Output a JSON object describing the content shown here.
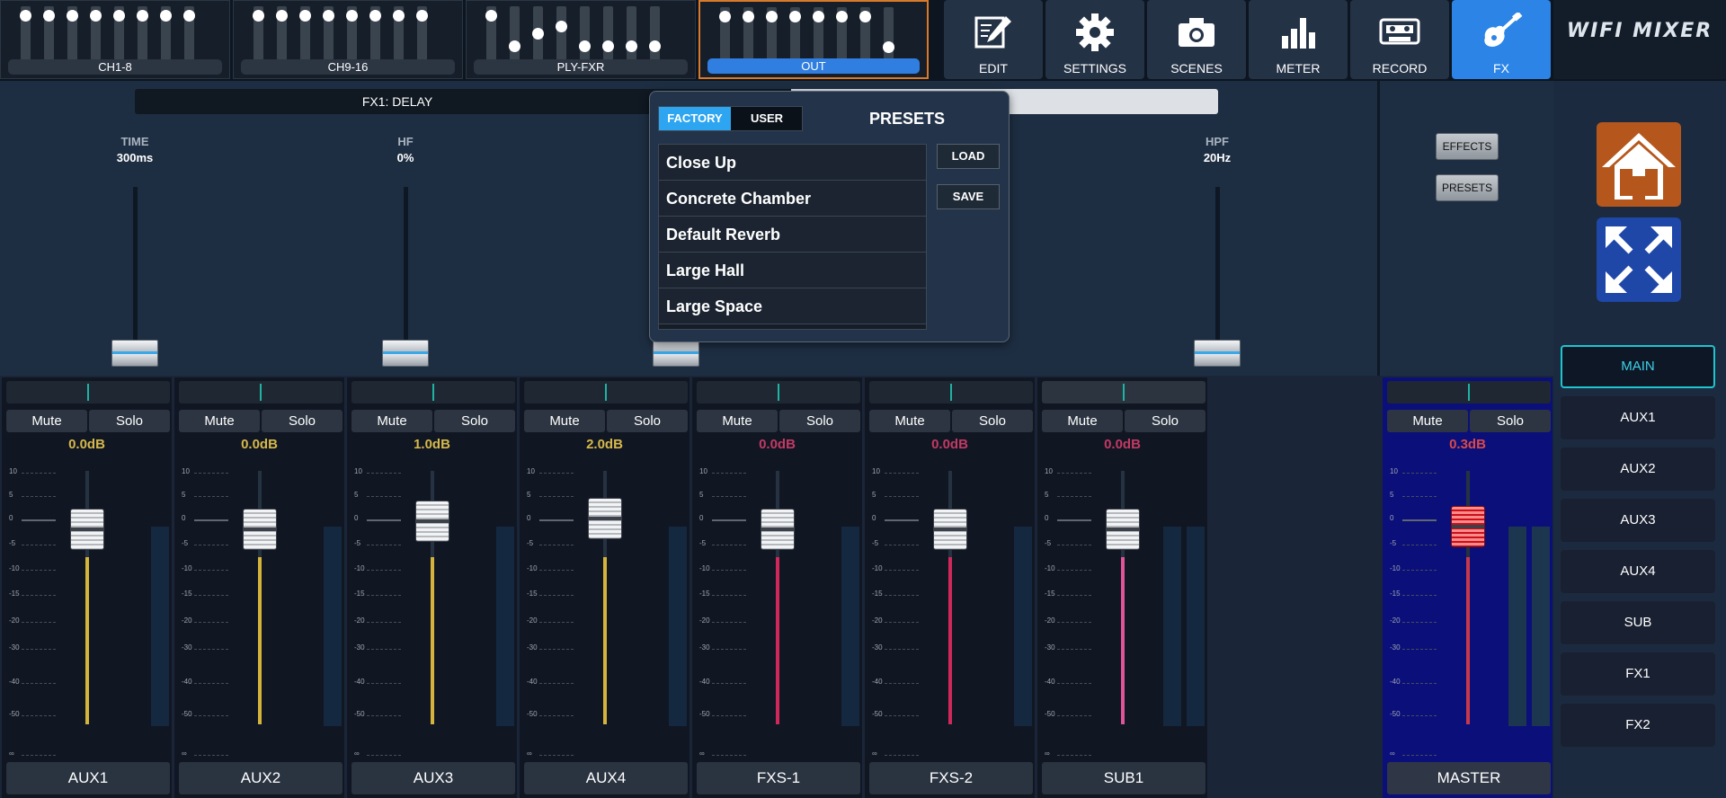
{
  "app": {
    "logo": "WIFI MIXER"
  },
  "banks": [
    {
      "label": "CH1-8",
      "levels": [
        0.92,
        0.92,
        0.92,
        0.92,
        0.92,
        0.92,
        0.92,
        0.92
      ],
      "active": false
    },
    {
      "label": "CH9-16",
      "levels": [
        0.92,
        0.92,
        0.92,
        0.92,
        0.92,
        0.92,
        0.92,
        0.92
      ],
      "active": false
    },
    {
      "label": "PLY-FXR",
      "levels": [
        0.92,
        0.2,
        0.5,
        0.65,
        0.2,
        0.2,
        0.2,
        0.2
      ],
      "active": false
    },
    {
      "label": "OUT",
      "levels": [
        0.92,
        0.92,
        0.92,
        0.92,
        0.92,
        0.92,
        0.92,
        0.2
      ],
      "active": true
    }
  ],
  "toolbar": [
    {
      "label": "EDIT",
      "icon": "edit-icon"
    },
    {
      "label": "SETTINGS",
      "icon": "gear-icon"
    },
    {
      "label": "SCENES",
      "icon": "camera-icon"
    },
    {
      "label": "METER",
      "icon": "bar-chart-icon"
    },
    {
      "label": "RECORD",
      "icon": "cassette-icon"
    },
    {
      "label": "FX",
      "icon": "guitar-icon",
      "active": true
    }
  ],
  "fx": {
    "name": "FX1: DELAY",
    "params": [
      {
        "name": "TIME",
        "value": "300ms",
        "level": 0.0
      },
      {
        "name": "HF",
        "value": "0%",
        "level": 0.0
      },
      {
        "name": "",
        "value": "",
        "level": 0.0
      },
      {
        "name": "HPF",
        "value": "20Hz",
        "level": 0.0
      }
    ],
    "effects_label": "EFFECTS",
    "presets_label": "PRESETS"
  },
  "presets": {
    "title": "PRESETS",
    "tabs": [
      "FACTORY",
      "USER"
    ],
    "selected_tab": "FACTORY",
    "items": [
      "Close Up",
      "Concrete Chamber",
      "Default Reverb",
      "Large Hall",
      "Large Space"
    ],
    "load_label": "LOAD",
    "save_label": "SAVE"
  },
  "mixer": {
    "mute_label": "Mute",
    "solo_label": "Solo",
    "scale": [
      "10",
      "5",
      "0",
      "-5",
      "-10",
      "-15",
      "-20",
      "-30",
      "-40",
      "-50",
      "∞"
    ],
    "strips": [
      {
        "name": "AUX1",
        "gain": "0.0dB",
        "gain_color": "#d6b94a",
        "line_color": "#d4b43a"
      },
      {
        "name": "AUX2",
        "gain": "0.0dB",
        "gain_color": "#d6b94a",
        "line_color": "#d4b43a"
      },
      {
        "name": "AUX3",
        "gain": "1.0dB",
        "gain_color": "#d6b94a",
        "line_color": "#d4b43a"
      },
      {
        "name": "AUX4",
        "gain": "2.0dB",
        "gain_color": "#d6b94a",
        "line_color": "#d4b43a"
      },
      {
        "name": "FXS-1",
        "gain": "0.0dB",
        "gain_color": "#c23a64",
        "line_color": "#d0285a"
      },
      {
        "name": "FXS-2",
        "gain": "0.0dB",
        "gain_color": "#c23a64",
        "line_color": "#d0285a"
      },
      {
        "name": "SUB1",
        "gain": "0.0dB",
        "gain_color": "#c23a64",
        "line_color": "#e0559a"
      },
      {
        "name": "MASTER",
        "gain": "0.3dB",
        "gain_color": "#d94a4a",
        "line_color": "#c8384a"
      }
    ]
  },
  "buses": [
    "MAIN",
    "AUX1",
    "AUX2",
    "AUX3",
    "AUX4",
    "SUB",
    "FX1",
    "FX2"
  ],
  "selected_bus": "MAIN"
}
